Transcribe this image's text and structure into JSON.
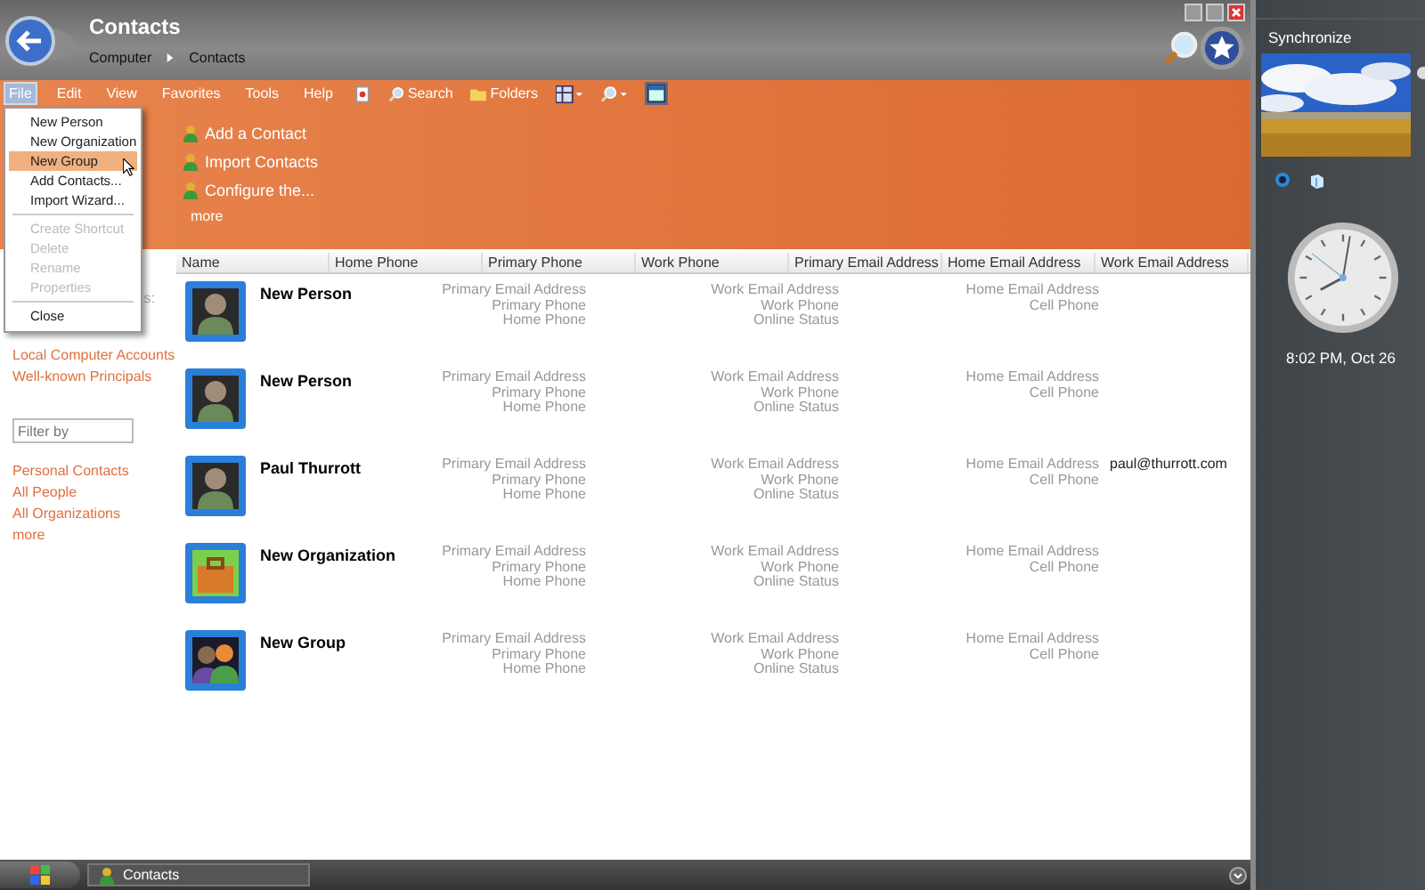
{
  "window": {
    "title": "Contacts",
    "breadcrumb": [
      "Computer",
      "Contacts"
    ]
  },
  "menu_bar": [
    {
      "label": "File",
      "selected": true
    },
    {
      "label": "Edit",
      "selected": false
    },
    {
      "label": "View",
      "selected": false
    },
    {
      "label": "Favorites",
      "selected": false
    },
    {
      "label": "Tools",
      "selected": false
    },
    {
      "label": "Help",
      "selected": false
    }
  ],
  "toolbar": [
    "Search",
    "Folders"
  ],
  "file_menu": [
    {
      "kind": "item",
      "label": "New Person",
      "selected": false,
      "disabled": false
    },
    {
      "kind": "item",
      "label": "New Organization",
      "selected": false,
      "disabled": false
    },
    {
      "kind": "item",
      "label": "New Group",
      "selected": true,
      "disabled": false
    },
    {
      "kind": "item",
      "label": "Add Contacts...",
      "selected": false,
      "disabled": false
    },
    {
      "kind": "item",
      "label": "Import Wizard...",
      "selected": false,
      "disabled": false
    },
    {
      "kind": "separator"
    },
    {
      "kind": "item",
      "label": "Create Shortcut",
      "selected": false,
      "disabled": true
    },
    {
      "kind": "item",
      "label": "Delete",
      "selected": false,
      "disabled": true
    },
    {
      "kind": "item",
      "label": "Rename",
      "selected": false,
      "disabled": true
    },
    {
      "kind": "item",
      "label": "Properties",
      "selected": false,
      "disabled": true
    },
    {
      "kind": "separator"
    },
    {
      "kind": "item",
      "label": "Close",
      "selected": false,
      "disabled": false
    }
  ],
  "tasks": [
    "Add a Contact",
    "Import Contacts",
    "Configure the..."
  ],
  "tasks_more": "more",
  "left_pane": {
    "heading": "s:",
    "links_top": [
      "Local Computer Accounts",
      "Well-known Principals"
    ],
    "filter": {
      "placeholder": "Filter by"
    },
    "links": [
      "Personal Contacts",
      "All People",
      "All Organizations"
    ],
    "more": "more"
  },
  "table": {
    "columns": [
      "Name",
      "Home Phone",
      "Primary Phone",
      "Work Phone",
      "Primary Email Address",
      "Home Email Address",
      "Work Email Address"
    ],
    "rows": [
      {
        "kind": "person",
        "name": "New Person",
        "fields_1": [
          "Primary Email Address",
          "Primary Phone",
          "Home Phone"
        ],
        "fields_2": [
          "Work Email Address",
          "Work Phone",
          "Online Status"
        ],
        "fields_3": [
          "Home Email Address",
          "Cell Phone"
        ]
      },
      {
        "kind": "person",
        "name": "New Person",
        "fields_1": [
          "Primary Email Address",
          "Primary Phone",
          "Home Phone"
        ],
        "fields_2": [
          "Work Email Address",
          "Work Phone",
          "Online Status"
        ],
        "fields_3": [
          "Home Email Address",
          "Cell Phone"
        ]
      },
      {
        "kind": "person",
        "name": "Paul Thurrott",
        "fields_1": [
          "Primary Email Address",
          "Primary Phone",
          "Home Phone"
        ],
        "fields_2": [
          "Work Email Address",
          "Work Phone",
          "Online Status"
        ],
        "fields_3": [
          "Home Email Address",
          "Cell Phone"
        ],
        "work_email": "paul@thurrott.com"
      },
      {
        "kind": "organization",
        "name": "New Organization",
        "fields_1": [
          "Primary Email Address",
          "Primary Phone",
          "Home Phone"
        ],
        "fields_2": [
          "Work Email Address",
          "Work Phone",
          "Online Status"
        ],
        "fields_3": [
          "Home Email Address",
          "Cell Phone"
        ]
      },
      {
        "kind": "group",
        "name": "New Group",
        "fields_1": [
          "Primary Email Address",
          "Primary Phone",
          "Home Phone"
        ],
        "fields_2": [
          "Work Email Address",
          "Work Phone",
          "Online Status"
        ],
        "fields_3": [
          "Home Email Address",
          "Cell Phone"
        ]
      }
    ]
  },
  "sidebar": {
    "title": "Synchronize",
    "time": "8:02 PM, Oct 26"
  },
  "taskbar": {
    "buttons": [
      "Contacts"
    ]
  }
}
